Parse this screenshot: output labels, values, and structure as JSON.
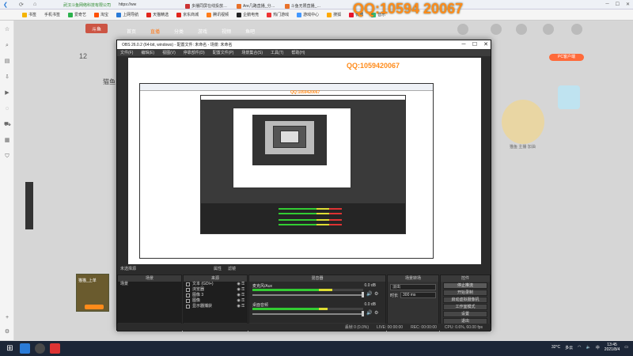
{
  "watermark": {
    "qq_big": "QQ:10594 20067",
    "qq_mid": "QQ:1059420067",
    "qq_small": "QQ:1059420067"
  },
  "browser": {
    "tabs": [
      "书签",
      "手机书签",
      "爱奇艺",
      "淘宝",
      "上网导航",
      "天猫精选",
      "京东商城",
      "腾讯视频",
      "企鹅电竞",
      "热门游戏",
      "游戏中心",
      "搜狐",
      "微博",
      "音乐"
    ],
    "tab_blocks": [
      "多播同屏在线投放…",
      "Are几路直播_分…",
      "斗鱼无限直播_…"
    ],
    "url": "https://ww",
    "company": "武汉斗鱼网络科技有限公司"
  },
  "site": {
    "logo": "斗鱼",
    "nav": [
      "首页",
      "直播",
      "分类",
      "游戏",
      "视频",
      "鱼吧"
    ],
    "count": "12",
    "pc_badge": "PC客户端",
    "name_label": "猫鱼",
    "thumb_caption": "猫猫_上单",
    "mascot_caption": "猫鱼 主播 加油"
  },
  "obs": {
    "title": "OBS 26.0.2 (64-bit, windows) - 配置文件: 未命名 - 场景: 未命名",
    "menu": [
      "文件(F)",
      "编辑(E)",
      "视图(V)",
      "停靠部件(D)",
      "配置文件(P)",
      "场景集合(S)",
      "工具(T)",
      "帮助(H)"
    ],
    "no_source": "未选择源",
    "prop_btn": "属性",
    "filter_btn": "滤镜",
    "docks": {
      "scenes": {
        "title": "场景",
        "items": [
          "场景"
        ]
      },
      "sources": {
        "title": "来源",
        "items": [
          "文本 (GDI+)",
          "浏览器",
          "图像 3",
          "图像",
          "显示器捕获"
        ]
      },
      "mixer": {
        "title": "混音器",
        "channels": [
          {
            "name": "麦克风/Aux",
            "db": "0.0 dB",
            "level": 0.72
          },
          {
            "name": "桌面音频",
            "db": "0.0 dB",
            "level": 0.68
          }
        ]
      },
      "transitions": {
        "title": "场景转场",
        "type": "淡出",
        "duration_label": "时长",
        "duration": "300 ms"
      },
      "controls": {
        "title": "控件",
        "buttons": [
          "停止推流",
          "开始录制",
          "启动虚拟摄像机",
          "工作室模式",
          "设置",
          "退出"
        ]
      }
    },
    "status": {
      "live": "LIVE: 00:00:00",
      "rec": "REC: 00:00:00",
      "cpu": "CPU: 0.6%, 60.00 fps",
      "dropped": "丢帧 0 (0.0%)"
    }
  },
  "taskbar": {
    "temp": "32°C",
    "weather": "多云",
    "time": "13:45",
    "date": "2021/8/4",
    "lang": "中"
  }
}
